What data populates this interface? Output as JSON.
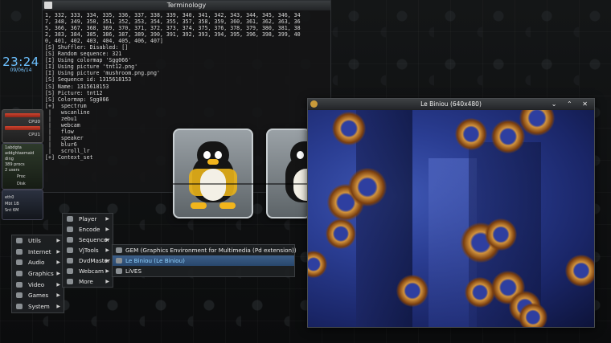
{
  "terminal": {
    "title": "Terminology",
    "lines": [
      "1, 332, 333, 334, 335, 336, 337, 338, 339, 340, 341, 342, 343, 344, 345, 346, 34",
      "7, 348, 349, 350, 351, 352, 353, 354, 355, 357, 358, 359, 360, 361, 362, 363, 36",
      "5, 366, 367, 368, 369, 370, 371, 372, 373, 374, 375, 376, 378, 379, 380, 381, 38",
      "2, 383, 384, 385, 386, 387, 389, 390, 391, 392, 393, 394, 395, 396, 398, 399, 40",
      "0, 401, 402, 403, 404, 405, 406, 407]",
      "[S] Shuffler: Disabled: []",
      "[S] Random sequence: 321",
      "[I] Using colormap 'Sgg066'",
      "[I] Using picture 'tnt12.png'",
      "[I] Using picture 'mushroom.png.png'",
      "[S] Sequence id: 1315618153",
      "[S] Name: 1315618153",
      "[S] Picture: tnt12",
      "[S] Colormap: Sgg066",
      "[+]  spectrum",
      " |   wscanline",
      " |   zebu1",
      " |   webcam",
      " |   flow",
      " |   speaker",
      " |   blur6",
      " |   scroll_lr",
      "[+] Context_set"
    ]
  },
  "clock": {
    "time": "23:24",
    "date": "09/06/14"
  },
  "gadgets": {
    "cpu0": "CPU0",
    "cpu1": "CPU1",
    "mem_lines": [
      "1abdgta",
      "addghtaemaid",
      "ding",
      "389 procs",
      "2 users"
    ],
    "proc": "Proc",
    "disk": "Disk",
    "net_lines": [
      "eth0",
      "Mbt 1B",
      "Snt 6M"
    ]
  },
  "biniou": {
    "title": "Le Biniou (640x480)",
    "controls": "⌄ ⌃ ✕"
  },
  "menus": {
    "root": [
      {
        "label": "Utils",
        "icon": "utils-icon",
        "sub": true
      },
      {
        "label": "Internet",
        "icon": "internet-icon",
        "sub": true
      },
      {
        "label": "Audio",
        "icon": "audio-icon",
        "sub": true
      },
      {
        "label": "Graphics",
        "icon": "graphics-icon",
        "sub": true
      },
      {
        "label": "Video",
        "icon": "video-icon",
        "sub": true
      },
      {
        "label": "Games",
        "icon": "games-icon",
        "sub": true
      },
      {
        "label": "System",
        "icon": "system-icon",
        "sub": true
      }
    ],
    "multimedia": [
      {
        "label": "Player",
        "icon": "player-icon",
        "sub": true
      },
      {
        "label": "Encode",
        "icon": "encode-icon",
        "sub": true
      },
      {
        "label": "Sequencer",
        "icon": "sequencer-icon",
        "sub": true
      },
      {
        "label": "VjTools",
        "icon": "vjtools-icon",
        "sub": true
      },
      {
        "label": "DvdMaster",
        "icon": "dvd-icon",
        "sub": true
      },
      {
        "label": "Webcam",
        "icon": "webcam-icon",
        "sub": true
      },
      {
        "label": "More",
        "icon": "more-icon",
        "sub": true
      }
    ],
    "vjtools": [
      {
        "label": "GEM (Graphics Environment for Multimedia (Pd extension))",
        "icon": "gem-icon"
      },
      {
        "label": "Le Biniou (Le Biniou)",
        "icon": "biniou-icon",
        "selected": true
      },
      {
        "label": "LiVES",
        "icon": "lives-icon"
      }
    ]
  },
  "colors": {
    "accent": "#8fd3ff",
    "clock": "#6cc0ff",
    "selection": "#3d5f88"
  }
}
